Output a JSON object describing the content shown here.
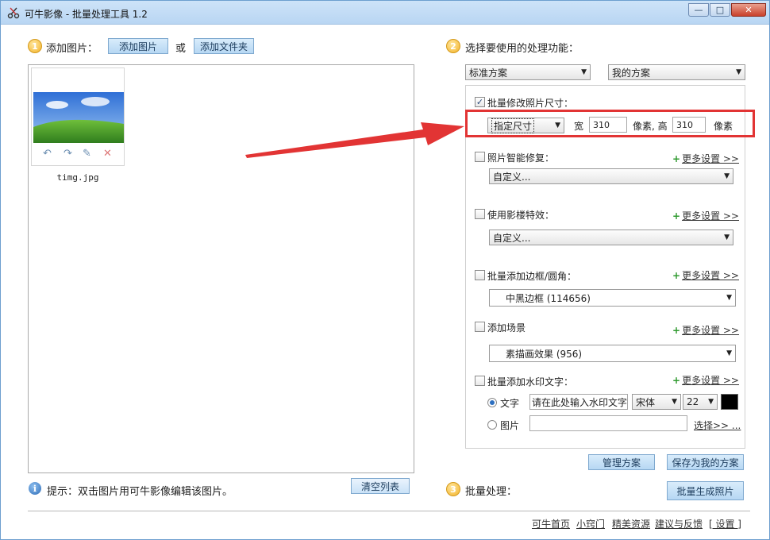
{
  "window": {
    "title": "可牛影像 - 批量处理工具 1.2",
    "controls": {
      "minimize": "—",
      "maximize": "□",
      "close": "✕"
    }
  },
  "left": {
    "step_number": "1",
    "add_label": "添加图片：",
    "add_image_button": "添加图片",
    "or_text": "或",
    "add_folder_button": "添加文件夹",
    "thumbnail": {
      "filename": "timg.jpg"
    },
    "tip_text": "提示：双击图片用可牛影像编辑该图片。",
    "clear_button": "清空列表"
  },
  "right": {
    "step2_number": "2",
    "step2_label": "选择要使用的处理功能：",
    "preset_select": "标准方案",
    "my_preset_select": "我的方案",
    "resize": {
      "checked": true,
      "label": "批量修改照片尺寸：",
      "mode": "指定尺寸",
      "width_label": "宽",
      "width_value": "310",
      "unit_height_label": "像素, 高",
      "height_value": "310",
      "unit": "像素"
    },
    "repair": {
      "label": "照片智能修复：",
      "option": "自定义..."
    },
    "studio": {
      "label": "使用影楼特效：",
      "option": "自定义..."
    },
    "border": {
      "label": "批量添加边框/圆角：",
      "option": "中黑边框 (114656)"
    },
    "scene": {
      "label": "添加场景",
      "option": "素描画效果 (956)"
    },
    "watermark": {
      "label": "批量添加水印文字：",
      "text_radio": "文字",
      "text_placeholder": "请在此处输入水印文字",
      "font": "宋体",
      "size": "22",
      "image_radio": "图片",
      "select_link": "选择>> ..."
    },
    "more_plus": "+",
    "more_settings": "更多设置 >>",
    "manage_button": "管理方案",
    "save_button": "保存为我的方案",
    "step3_number": "3",
    "step3_label": "批量处理：",
    "generate_button": "批量生成照片"
  },
  "footer": {
    "links": [
      "可牛首页",
      "小窍门",
      "精美资源",
      "建议与反馈",
      "[ 设置 ]"
    ]
  },
  "colors": {
    "accent": "#2d6fc0",
    "highlight": "#e23434"
  }
}
